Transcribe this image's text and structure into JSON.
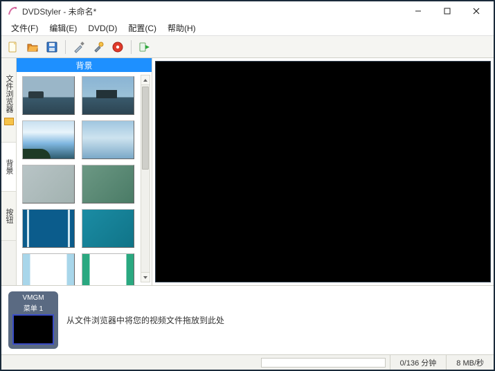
{
  "window": {
    "title": "DVDStyler - 未命名*"
  },
  "menu": {
    "file": "文件(F)",
    "edit": "编辑(E)",
    "dvd": "DVD(D)",
    "config": "配置(C)",
    "help": "帮助(H)"
  },
  "toolbar_icons": {
    "new": "new-file-icon",
    "open": "open-folder-icon",
    "save": "save-icon",
    "brush": "brush-icon",
    "wrench": "wrench-tool-icon",
    "burn": "burn-disc-icon",
    "play": "play-arrow-icon"
  },
  "side_tabs": {
    "browser": "文件浏览器",
    "background": "背景",
    "button": "按钮"
  },
  "thumbs": {
    "header": "背景",
    "items": [
      {
        "name": "background-ocean-cloudy"
      },
      {
        "name": "background-harbor-ships"
      },
      {
        "name": "background-lake-aerial"
      },
      {
        "name": "background-sky-gradient"
      },
      {
        "name": "background-grey-blur"
      },
      {
        "name": "background-green-blur"
      },
      {
        "name": "background-blue-stripe"
      },
      {
        "name": "background-teal-solid"
      },
      {
        "name": "background-lightblue-frame"
      },
      {
        "name": "background-green-frame"
      }
    ]
  },
  "menu_card": {
    "group": "VMGM",
    "label": "菜单 1"
  },
  "drop_hint": "从文件浏览器中将您的视频文件拖放到此处",
  "status": {
    "time": "0/136 分钟",
    "rate": "8 MB/秒"
  }
}
